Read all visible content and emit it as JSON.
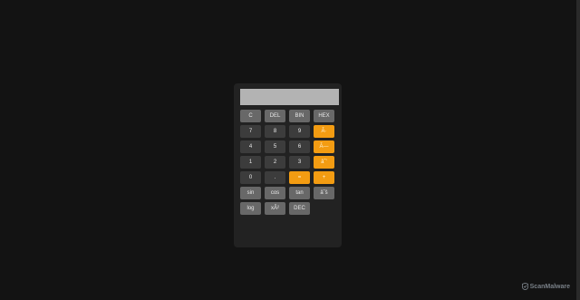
{
  "display": {
    "value": ""
  },
  "buttons": {
    "row1": [
      "C",
      "DEL",
      "BIN",
      "HEX"
    ],
    "row2": [
      "7",
      "8",
      "9",
      "Ã·"
    ],
    "row3": [
      "4",
      "5",
      "6",
      "Ã—"
    ],
    "row4": [
      "1",
      "2",
      "3",
      "âˆ’"
    ],
    "row5": [
      "0",
      ".",
      "=",
      "+"
    ],
    "row6": [
      "sin",
      "cos",
      "tan",
      "âˆš"
    ],
    "row7": [
      "log",
      "xÂ²",
      "DEC"
    ]
  },
  "watermark": {
    "text": "ScanMalware",
    "icon": "scanmalware-logo"
  },
  "colors": {
    "background": "#131313",
    "calculator": "#222222",
    "display": "#b3b3b3",
    "function_key": "#686868",
    "number_key": "#3c3c3c",
    "operator_key": "#f39c12"
  }
}
